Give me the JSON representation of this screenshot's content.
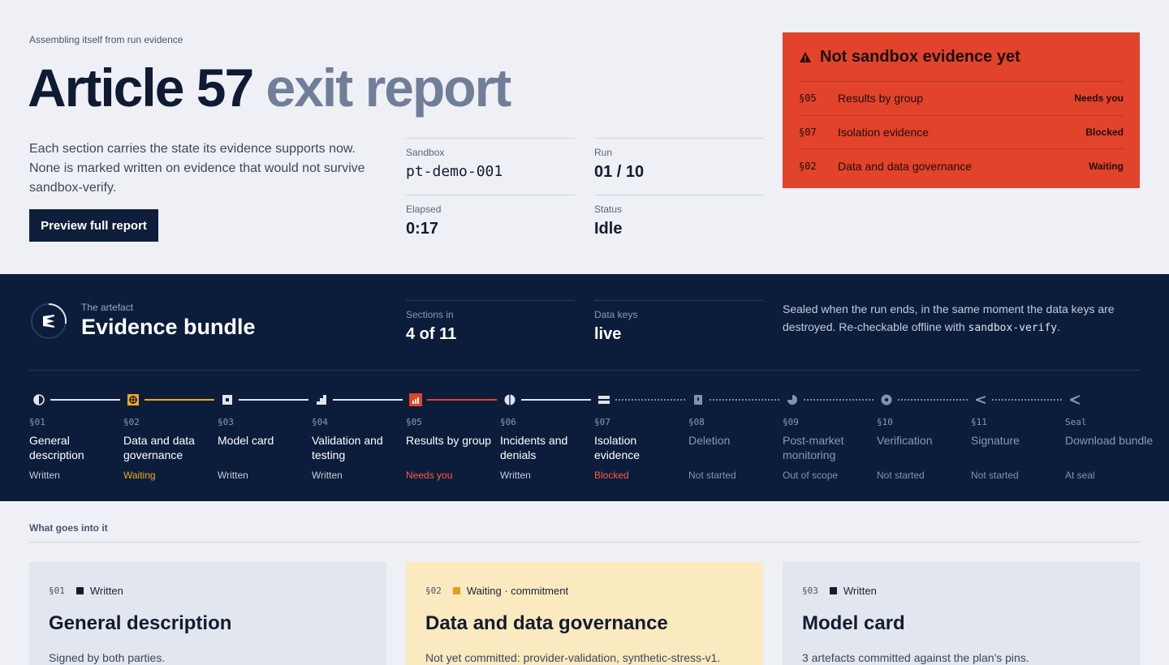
{
  "header": {
    "eyebrow": "Assembling itself from run evidence",
    "title_main": "Article 57",
    "title_accent": "exit report",
    "intro": "Each section carries the state its evidence supports now. None is marked written on evidence that would not survive sandbox-verify.",
    "preview_button": "Preview full report",
    "meta": [
      {
        "label": "Sandbox",
        "value": "pt-demo-001"
      },
      {
        "label": "Run",
        "value": "01 / 10"
      },
      {
        "label": "Elapsed",
        "value": "0:17"
      },
      {
        "label": "Status",
        "value": "Idle"
      }
    ]
  },
  "alert": {
    "icon": "warning-icon",
    "title": "Not sandbox evidence yet",
    "rows": [
      {
        "section": "§05",
        "name": "Results by group",
        "state": "Needs you"
      },
      {
        "section": "§07",
        "name": "Isolation evidence",
        "state": "Blocked"
      },
      {
        "section": "§02",
        "name": "Data and data governance",
        "state": "Waiting"
      }
    ]
  },
  "band": {
    "eyebrow": "The artefact",
    "title": "Evidence bundle",
    "sections_label": "Sections in",
    "sections_value": "4 of 11",
    "keys_label": "Data keys",
    "keys_value": "live",
    "sealed_text_1": "Sealed when the run ends, in the same moment the data keys are destroyed. Re-checkable offline with",
    "sealed_code": "sandbox-verify",
    "sealed_text_2": ".",
    "colors": {
      "background": "#0c1d3b",
      "written": "#dfe4ee",
      "waiting": "#f0a821",
      "alert": "#e2432b"
    },
    "steps": [
      {
        "section": "§01",
        "label": "General description",
        "state": "Written",
        "kind": "written",
        "icon": "half-circle-icon"
      },
      {
        "section": "§02",
        "label": "Data and data governance",
        "state": "Waiting",
        "kind": "waiting",
        "icon": "target-icon"
      },
      {
        "section": "§03",
        "label": "Model card",
        "state": "Written",
        "kind": "written",
        "icon": "card-icon"
      },
      {
        "section": "§04",
        "label": "Validation and testing",
        "state": "Written",
        "kind": "written",
        "icon": "steps-icon"
      },
      {
        "section": "§05",
        "label": "Results by group",
        "state": "Needs you",
        "kind": "needs",
        "icon": "bar-chart-icon"
      },
      {
        "section": "§06",
        "label": "Incidents and denials",
        "state": "Written",
        "kind": "written",
        "icon": "split-circle-icon"
      },
      {
        "section": "§07",
        "label": "Isolation evidence",
        "state": "Blocked",
        "kind": "blocked",
        "icon": "layers-icon"
      },
      {
        "section": "§08",
        "label": "Deletion",
        "state": "Not started",
        "kind": "dim",
        "icon": "trash-box-icon"
      },
      {
        "section": "§09",
        "label": "Post-market monitoring",
        "state": "Out of scope",
        "kind": "dim",
        "icon": "pie-icon"
      },
      {
        "section": "§10",
        "label": "Verification",
        "state": "Not started",
        "kind": "dim",
        "icon": "check-circle-icon"
      },
      {
        "section": "§11",
        "label": "Signature",
        "state": "Not started",
        "kind": "dim",
        "icon": "signature-icon"
      },
      {
        "section": "Seal",
        "label": "Download bundle",
        "state": "At seal",
        "kind": "dim",
        "icon": "seal-icon"
      }
    ]
  },
  "content": {
    "eyebrow": "What goes into it",
    "cards": [
      {
        "section": "§01",
        "state": "Written",
        "title": "General description",
        "desc": "Signed by both parties."
      },
      {
        "section": "§02",
        "state": "Waiting · commitment",
        "title": "Data and data governance",
        "desc": "Not yet committed: provider-validation, synthetic-stress-v1."
      },
      {
        "section": "§03",
        "state": "Written",
        "title": "Model card",
        "desc": "3 artefacts committed against the plan's pins."
      }
    ]
  }
}
